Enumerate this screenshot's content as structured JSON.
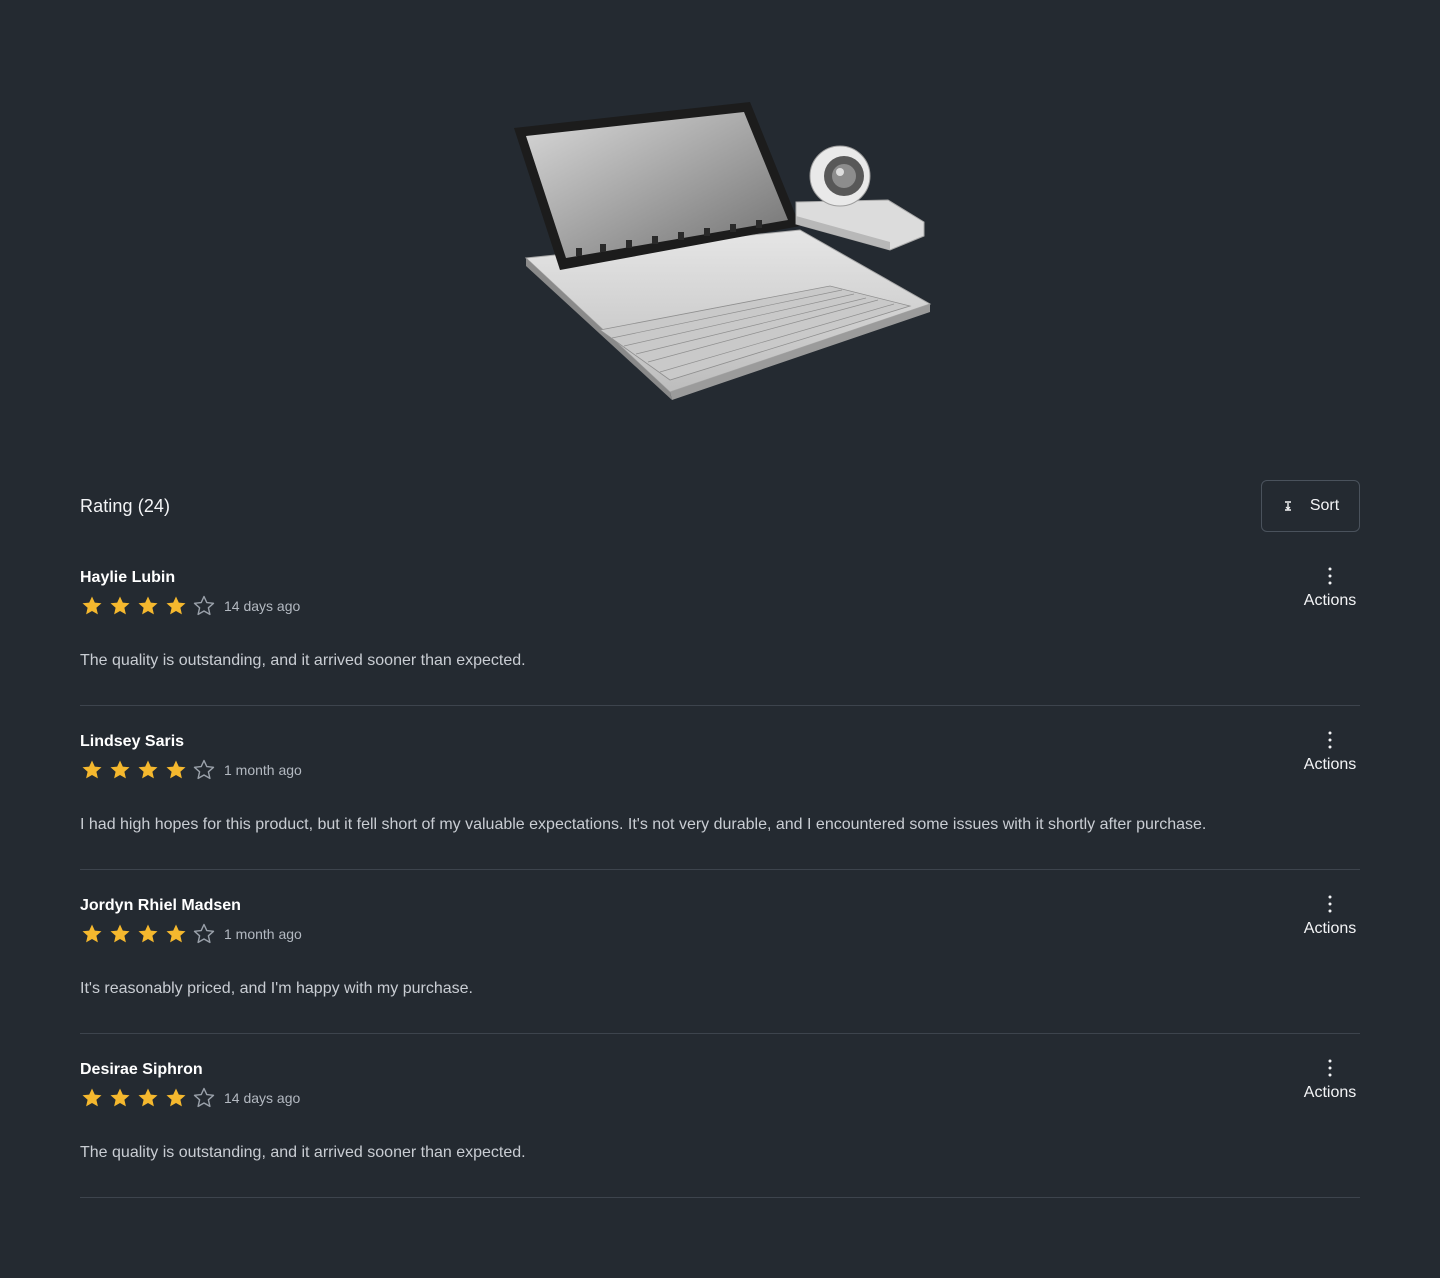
{
  "product": {
    "image_icon": "tablet-keyboard-dock-product-image"
  },
  "rating": {
    "title": "Rating (24)",
    "sort_label": "Sort",
    "sort_icon": "sort-icon"
  },
  "colors": {
    "background": "#242a31",
    "star_filled": "#f5b82e",
    "star_empty": "#9aa1aa",
    "divider": "#3d444d"
  },
  "reviews": [
    {
      "name": "Haylie Lubin",
      "rating": 4,
      "max_rating": 5,
      "date": "14 days ago",
      "text": "The quality is outstanding, and it arrived sooner than expected.",
      "actions_label": "Actions"
    },
    {
      "name": "Lindsey Saris",
      "rating": 4,
      "max_rating": 5,
      "date": "1 month ago",
      "text": "I had high hopes for this product, but it fell short of my valuable expectations. It's not very durable, and I encountered some issues with it shortly after purchase.",
      "actions_label": "Actions"
    },
    {
      "name": "Jordyn Rhiel Madsen",
      "rating": 4,
      "max_rating": 5,
      "date": "1 month ago",
      "text": "It's reasonably priced, and I'm happy with my purchase.",
      "actions_label": "Actions"
    },
    {
      "name": "Desirae Siphron",
      "rating": 4,
      "max_rating": 5,
      "date": "14 days ago",
      "text": "The quality is outstanding, and it arrived sooner than expected.",
      "actions_label": "Actions"
    }
  ]
}
